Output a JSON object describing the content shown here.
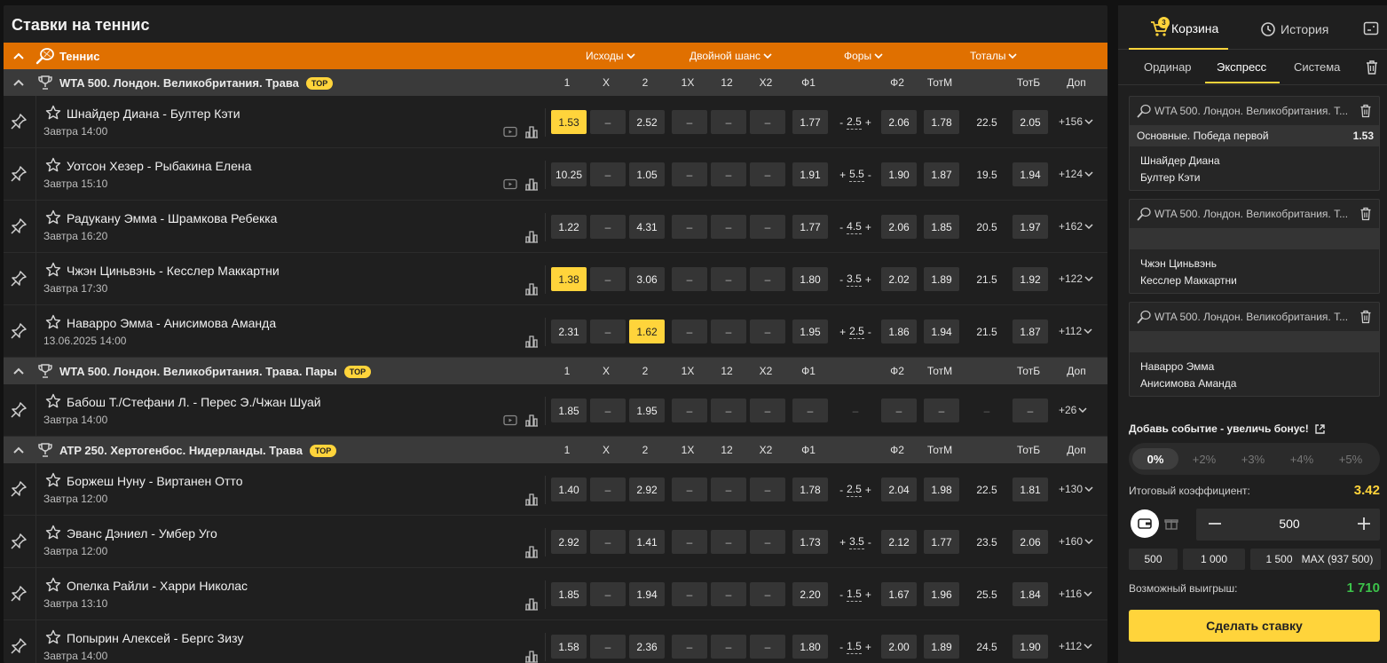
{
  "page_title": "Ставки на теннис",
  "sport": {
    "name": "Теннис"
  },
  "market_groups": [
    {
      "label": "Исходы"
    },
    {
      "label": "Двойной шанс"
    },
    {
      "label": "Форы"
    },
    {
      "label": "Тоталы"
    }
  ],
  "column_headers": [
    "1",
    "X",
    "2",
    "1X",
    "12",
    "X2",
    "Ф1",
    "Ф2",
    "ТотМ",
    "ТотБ",
    "Доп"
  ],
  "top_badge": "TOP",
  "dash": "–",
  "leagues": [
    {
      "name": "WTA 500. Лондон. Великобритания. Трава",
      "events": [
        {
          "teams": "Шнайдер Диана - Бултер Кэти",
          "time": "Завтра 14:00",
          "video": true,
          "odds": [
            "1.53",
            "–",
            "2.52",
            "–",
            "–",
            "–",
            "1.77",
            "2.06",
            "1.78",
            "2.05"
          ],
          "handicap": {
            "l": "-",
            "v": "2.5",
            "r": "+"
          },
          "total": "22.5",
          "more": "+156",
          "selected": [
            0
          ]
        },
        {
          "teams": "Уотсон Хезер - Рыбакина Елена",
          "time": "Завтра 15:10",
          "video": true,
          "odds": [
            "10.25",
            "–",
            "1.05",
            "–",
            "–",
            "–",
            "1.91",
            "1.90",
            "1.87",
            "1.94"
          ],
          "handicap": {
            "l": "+",
            "v": "5.5",
            "r": "-"
          },
          "total": "19.5",
          "more": "+124",
          "selected": []
        },
        {
          "teams": "Радукану Эмма - Шрамкова Ребекка",
          "time": "Завтра 16:20",
          "video": false,
          "odds": [
            "1.22",
            "–",
            "4.31",
            "–",
            "–",
            "–",
            "1.77",
            "2.06",
            "1.85",
            "1.97"
          ],
          "handicap": {
            "l": "-",
            "v": "4.5",
            "r": "+"
          },
          "total": "20.5",
          "more": "+162",
          "selected": []
        },
        {
          "teams": "Чжэн Циньвэнь - Кесслер Маккартни",
          "time": "Завтра 17:30",
          "video": false,
          "odds": [
            "1.38",
            "–",
            "3.06",
            "–",
            "–",
            "–",
            "1.80",
            "2.02",
            "1.89",
            "1.92"
          ],
          "handicap": {
            "l": "-",
            "v": "3.5",
            "r": "+"
          },
          "total": "21.5",
          "more": "+122",
          "selected": [
            0
          ]
        },
        {
          "teams": "Наварро Эмма - Анисимова Аманда",
          "time": "13.06.2025 14:00",
          "video": false,
          "odds": [
            "2.31",
            "–",
            "1.62",
            "–",
            "–",
            "–",
            "1.95",
            "1.86",
            "1.94",
            "1.87"
          ],
          "handicap": {
            "l": "+",
            "v": "2.5",
            "r": "-"
          },
          "total": "21.5",
          "more": "+112",
          "selected": [
            2
          ]
        }
      ]
    },
    {
      "name": "WTA 500. Лондон. Великобритания. Трава. Пары",
      "events": [
        {
          "teams": "Бабош Т./Стефани Л. - Перес Э./Чжан Шуай",
          "time": "Завтра 14:00",
          "video": true,
          "odds": [
            "1.85",
            "–",
            "1.95",
            "–",
            "–",
            "–",
            "–",
            "–",
            "–",
            "–"
          ],
          "handicap": null,
          "total": null,
          "more": "+26",
          "selected": []
        }
      ]
    },
    {
      "name": "ATP 250. Хертогенбос. Нидерланды. Трава",
      "events": [
        {
          "teams": "Боржеш Нуну - Виртанен Отто",
          "time": "Завтра 12:00",
          "video": false,
          "odds": [
            "1.40",
            "–",
            "2.92",
            "–",
            "–",
            "–",
            "1.78",
            "2.04",
            "1.98",
            "1.81"
          ],
          "handicap": {
            "l": "-",
            "v": "2.5",
            "r": "+"
          },
          "total": "22.5",
          "more": "+130",
          "selected": []
        },
        {
          "teams": "Эванс Дэниел - Умбер Уго",
          "time": "Завтра 12:00",
          "video": false,
          "odds": [
            "2.92",
            "–",
            "1.41",
            "–",
            "–",
            "–",
            "1.73",
            "2.12",
            "1.77",
            "2.06"
          ],
          "handicap": {
            "l": "+",
            "v": "3.5",
            "r": "-"
          },
          "total": "23.5",
          "more": "+160",
          "selected": []
        },
        {
          "teams": "Опелка Райли - Харри Николас",
          "time": "Завтра 13:10",
          "video": false,
          "odds": [
            "1.85",
            "–",
            "1.94",
            "–",
            "–",
            "–",
            "2.20",
            "1.67",
            "1.96",
            "1.84"
          ],
          "handicap": {
            "l": "-",
            "v": "1.5",
            "r": "+"
          },
          "total": "25.5",
          "more": "+116",
          "selected": []
        },
        {
          "teams": "Попырин Алексей - Бергс Зизу",
          "time": "Завтра 14:00",
          "video": false,
          "odds": [
            "1.58",
            "–",
            "2.36",
            "–",
            "–",
            "–",
            "1.80",
            "2.00",
            "1.89",
            "1.90"
          ],
          "handicap": {
            "l": "-",
            "v": "1.5",
            "r": "+"
          },
          "total": "24.5",
          "more": "+112",
          "selected": []
        }
      ]
    }
  ],
  "slip": {
    "tab_basket": "Корзина",
    "basket_count": "3",
    "tab_history": "История",
    "modes": [
      "Ординар",
      "Экспресс",
      "Система"
    ],
    "active_mode": "Экспресс",
    "bets": [
      {
        "league": "WTA 500. Лондон. Великобритания. Т...",
        "market": "Основные. Победа первой",
        "odd": "1.53",
        "p1": "Шнайдер Диана",
        "p2": "Бултер Кэти"
      },
      {
        "league": "WTA 500. Лондон. Великобритания. Т...",
        "market": "",
        "odd": "",
        "p1": "Чжэн Циньвэнь",
        "p2": "Кесслер Маккартни"
      },
      {
        "league": "WTA 500. Лондон. Великобритания. Т...",
        "market": "",
        "odd": "",
        "p1": "Наварро Эмма",
        "p2": "Анисимова Аманда"
      }
    ],
    "bonus_title": "Добавь событие - увеличь бонус!",
    "bonus_options": [
      "0%",
      "+2%",
      "+3%",
      "+4%",
      "+5%"
    ],
    "total_label": "Итоговый коэффициент:",
    "total_value": "3.42",
    "stake": "500",
    "quick_amounts": [
      "500",
      "1 000",
      "1 500",
      "MAX (937 500)"
    ],
    "win_label": "Возможный выигрыш:",
    "win_value": "1 710",
    "submit": "Сделать ставку",
    "colors": {
      "accent": "#ffd43b",
      "win": "#3cc24a",
      "sport_bar": "#e07000"
    }
  }
}
